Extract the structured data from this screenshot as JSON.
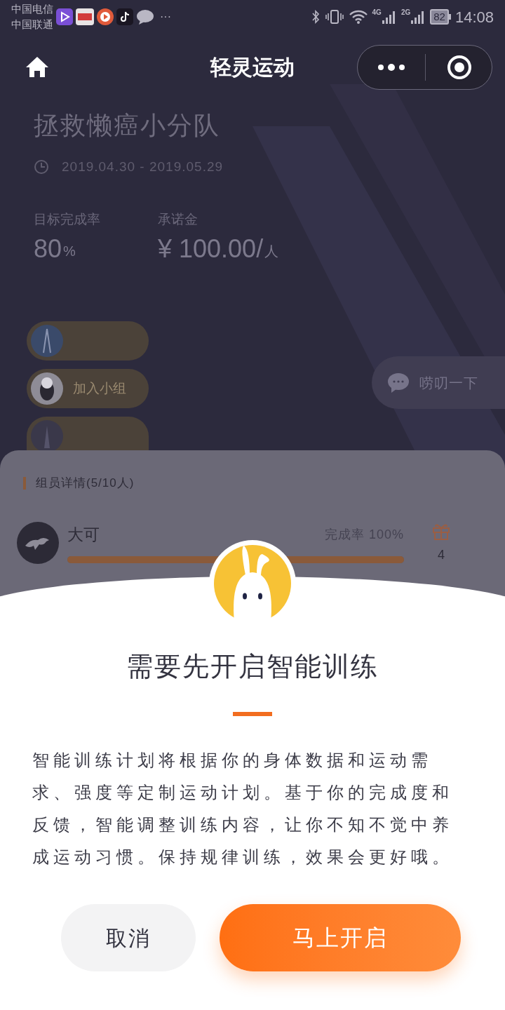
{
  "status_bar": {
    "carriers": [
      "中国电信",
      "中国联通"
    ],
    "more": "···",
    "networks": [
      "4G",
      "2G"
    ],
    "battery": "82",
    "time": "14:08"
  },
  "nav_bar": {
    "title": "轻灵运动"
  },
  "team": {
    "name": "拯救懒癌小分队",
    "date_range": "2019.04.30 - 2019.05.29",
    "stats": [
      {
        "label": "目标完成率",
        "value": "80",
        "unit": "%"
      },
      {
        "label": "承诺金",
        "value": "¥ 100.00/",
        "unit": "人"
      }
    ],
    "pills": [
      {
        "kind": "sky"
      },
      {
        "kind": "panda",
        "label": "加入小组"
      },
      {
        "kind": "figure"
      }
    ],
    "chat_button": "唠叨一下"
  },
  "members_panel": {
    "heading": "组员详情(5/10人)",
    "members": [
      {
        "name": "大可",
        "rate": "完成率 100%",
        "level": 1.0,
        "gifts": "4"
      }
    ]
  },
  "dialog": {
    "title": "需要先开启智能训练",
    "text": "智能训练计划将根据你的身体数据和运动需求、强度等定制运动计划。基于你的完成度和反馈，智能调整训练内容，让你不知不觉中养成运动习惯。保持规律训练，效果会更好哦。",
    "buttons": [
      {
        "label": "取消",
        "kind": "secondary"
      },
      {
        "label": "马上开启",
        "kind": "primary"
      }
    ]
  }
}
